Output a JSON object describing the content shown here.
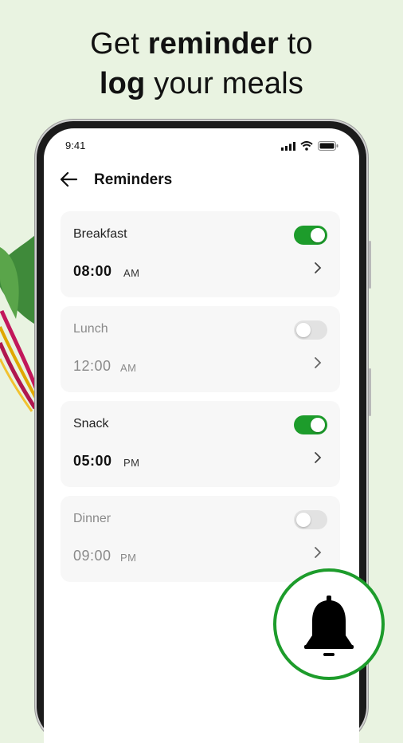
{
  "headline": {
    "line1_pre": "Get ",
    "line1_bold": "reminder",
    "line1_post": " to",
    "line2_bold": "log",
    "line2_post": " your meals"
  },
  "status_bar": {
    "time": "9:41"
  },
  "app_bar": {
    "title": "Reminders"
  },
  "reminders": [
    {
      "label": "Breakfast",
      "time": "08:00",
      "ampm": "AM",
      "enabled": true
    },
    {
      "label": "Lunch",
      "time": "12:00",
      "ampm": "AM",
      "enabled": false
    },
    {
      "label": "Snack",
      "time": "05:00",
      "ampm": "PM",
      "enabled": true
    },
    {
      "label": "Dinner",
      "time": "09:00",
      "ampm": "PM",
      "enabled": false
    }
  ],
  "icons": {
    "back": "arrow-left-icon",
    "chevron": "chevron-right-icon",
    "bell": "bell-icon",
    "signal": "signal-icon",
    "wifi": "wifi-icon",
    "battery": "battery-icon"
  },
  "colors": {
    "background": "#e9f3e1",
    "accent": "#1d9c2b",
    "toggle_off": "#e2e2e2",
    "card": "#f7f7f7"
  }
}
